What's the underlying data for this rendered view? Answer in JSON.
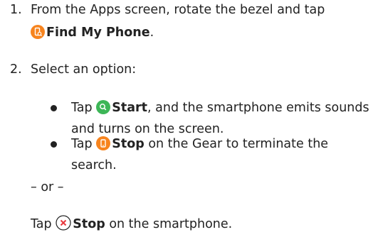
{
  "steps": [
    {
      "num": "1.",
      "line1": "From the Apps screen, rotate the bezel and tap",
      "app_name": "Find My Phone",
      "end": ".",
      "icon": "find-my-phone-app-icon"
    },
    {
      "num": "2.",
      "text": "Select an option:",
      "options": [
        {
          "lead": "Tap",
          "label": "Start",
          "rest1": ", and the smartphone emits sounds",
          "rest2": "and turns on the screen.",
          "icon": "start-search-icon"
        },
        {
          "lead": "Tap",
          "label": "Stop",
          "rest1": " on the Gear to terminate the",
          "rest2": "search.",
          "icon": "stop-phone-icon"
        }
      ],
      "separator": "– or –",
      "alt_lead": "Tap",
      "alt_label": "Stop",
      "alt_rest": " on the smartphone.",
      "alt_icon": "close-x-icon"
    }
  ],
  "colors": {
    "orange": "#F7841E",
    "green": "#3DB657",
    "red": "#E8383D",
    "text": "#222222"
  }
}
